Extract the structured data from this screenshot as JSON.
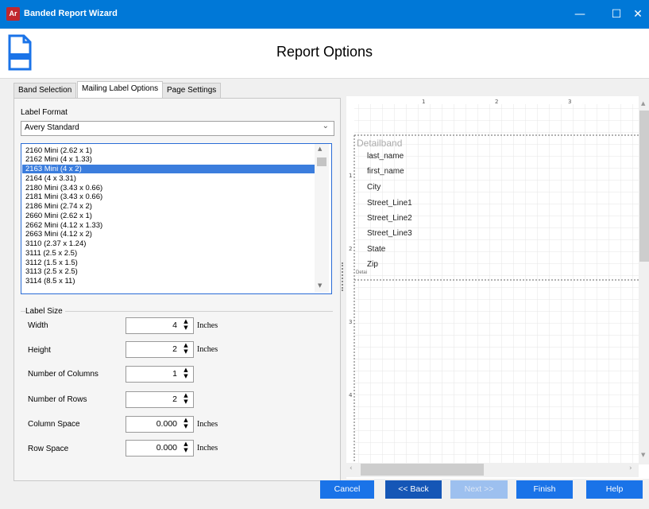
{
  "window": {
    "app_icon_text": "Ar",
    "title": "Banded Report Wizard",
    "minimize_icon": "minimize-icon",
    "maximize_icon": "maximize-icon",
    "close_icon": "close-icon",
    "accent_color": "#0078d7"
  },
  "header": {
    "icon": "report-document-icon",
    "title": "Report Options"
  },
  "tabs": [
    {
      "label": "Band Selection",
      "active": false
    },
    {
      "label": "Mailing Label Options",
      "active": true
    },
    {
      "label": "Page Settings",
      "active": false
    }
  ],
  "label_format": {
    "label": "Label Format",
    "selected": "Avery Standard"
  },
  "label_list": {
    "items": [
      "2160 Mini (2.62 x 1)",
      "2162 Mini (4 x 1.33)",
      "2163 Mini (4 x 2)",
      "2164 (4 x 3.31)",
      "2180 Mini (3.43 x 0.66)",
      "2181 Mini (3.43 x 0.66)",
      "2186 Mini (2.74 x 2)",
      "2660 Mini (2.62 x 1)",
      "2662 Mini (4.12 x 1.33)",
      "2663 Mini (4.12 x 2)",
      "3110 (2.37 x 1.24)",
      "3111 (2.5 x 2.5)",
      "3112 (1.5 x 1.5)",
      "3113 (2.5 x 2.5)",
      "3114 (8.5 x 11)"
    ],
    "selected_index": 2
  },
  "label_size": {
    "group_label": "Label Size",
    "rows": [
      {
        "label": "Width",
        "value": "4",
        "unit": "Inches"
      },
      {
        "label": "Height",
        "value": "2",
        "unit": "Inches"
      },
      {
        "label": "Number of Columns",
        "value": "1",
        "unit": ""
      },
      {
        "label": "Number of Rows",
        "value": "2",
        "unit": ""
      },
      {
        "label": "Column Space",
        "value": "0.000",
        "unit": "Inches"
      },
      {
        "label": "Row Space",
        "value": "0.000",
        "unit": "Inches"
      }
    ]
  },
  "preview": {
    "ruler_top": [
      "1",
      "2",
      "3"
    ],
    "ruler_left": [
      "1",
      "2",
      "3",
      "4"
    ],
    "band_label": "Detailband",
    "fields": [
      "last_name",
      "first_name",
      "City",
      "Street_Line1",
      "Street_Line2",
      "Street_Line3",
      "State",
      "Zip"
    ],
    "band_footer_label": "Detai"
  },
  "footer": {
    "cancel": "Cancel",
    "back": "<< Back",
    "next": "Next >>",
    "finish": "Finish",
    "help": "Help"
  }
}
